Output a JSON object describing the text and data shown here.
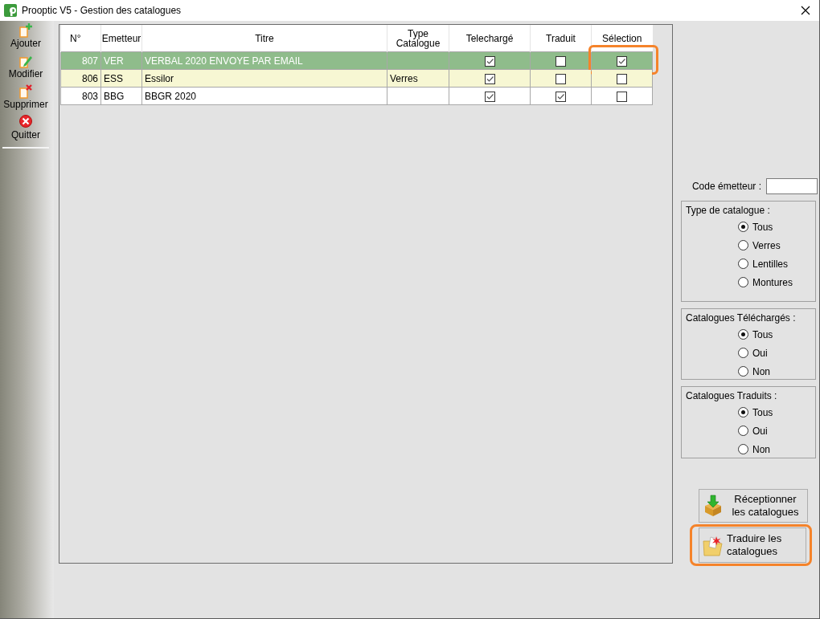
{
  "window": {
    "title": "Prooptic V5 - Gestion des catalogues"
  },
  "toolbar": [
    {
      "label": "Ajouter",
      "kind": "add"
    },
    {
      "label": "Modifier",
      "kind": "edit"
    },
    {
      "label": "Supprimer",
      "kind": "delete"
    },
    {
      "label": "Quitter",
      "kind": "quit"
    }
  ],
  "table": {
    "columns": [
      "N°",
      "Emetteur",
      "Titre",
      "Type\nCatalogue",
      "Telechargé",
      "Traduit",
      "Sélection"
    ],
    "rows": [
      {
        "number": "807",
        "emetteur": "VER",
        "titre": "VERBAL 2020 ENVOYE PAR EMAIL",
        "telecharge": true,
        "traduit": false,
        "selection": true,
        "selection_highlighted": true,
        "selected": true
      },
      {
        "number": "806",
        "emetteur": "ESS",
        "titre": "Essilor",
        "type": "Verres",
        "telecharge": true,
        "traduit": false,
        "selection": false,
        "selection_highlighted": false,
        "selected": false
      },
      {
        "number": "803",
        "emetteur": "BBG",
        "titre": "BBGR 2020",
        "telecharge": true,
        "traduit": true,
        "selection": false,
        "selection_highlighted": false,
        "selected": false
      }
    ]
  },
  "filters": {
    "code_emetteur": {
      "label": "Code émetteur :"
    },
    "groups": [
      {
        "title": "Type de catalogue :",
        "options": [
          {
            "label": "Tous",
            "selected": true
          },
          {
            "label": "Verres",
            "selected": false
          },
          {
            "label": "Lentilles",
            "selected": false
          },
          {
            "label": "Montures",
            "selected": false
          }
        ]
      },
      {
        "title": "Catalogues Téléchargés :",
        "options": [
          {
            "label": "Tous",
            "selected": true
          },
          {
            "label": "Oui",
            "selected": false
          },
          {
            "label": "Non",
            "selected": false
          }
        ]
      },
      {
        "title": "Catalogues Traduits :",
        "options": [
          {
            "label": "Tous",
            "selected": true
          },
          {
            "label": "Oui",
            "selected": false
          },
          {
            "label": "Non",
            "selected": false
          }
        ]
      }
    ]
  },
  "actions": [
    {
      "label": "Réceptionner\nles catalogues",
      "kind": "receive",
      "highlighted": false
    },
    {
      "label": "Traduire les\ncatalogues",
      "kind": "translate",
      "highlighted": true
    }
  ]
}
